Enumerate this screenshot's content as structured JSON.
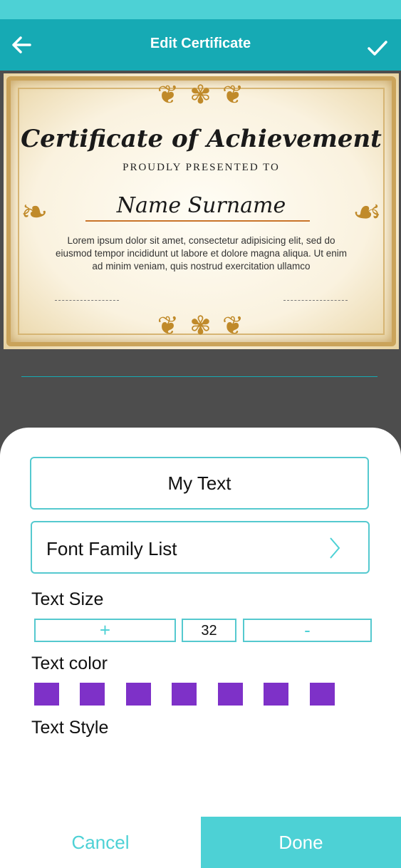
{
  "toolbar": {
    "title": "Edit Certificate",
    "back_icon": "arrow-left-icon",
    "confirm_icon": "check-icon"
  },
  "certificate": {
    "heading": "Certificate of Achievement",
    "subheading": "PROUDLY PRESENTED TO",
    "name": "Name Surname",
    "body": "Lorem ipsum dolor sit amet, consectetur adipisicing elit, sed do eiusmod tempor incididunt ut labore et dolore magna aliqua. Ut enim ad minim veniam, quis nostrud exercitation ullamco"
  },
  "editor": {
    "text_value": "My Text",
    "font_family_label": "Font Family List",
    "text_size_label": "Text Size",
    "increase_label": "+",
    "size_value": "32",
    "decrease_label": "-",
    "text_color_label": "Text color",
    "swatch_color": "#7e31c8",
    "swatch_count": 7,
    "text_style_label": "Text Style"
  },
  "actions": {
    "cancel_label": "Cancel",
    "done_label": "Done"
  },
  "colors": {
    "status_bar": "#4dd1d5",
    "toolbar": "#16aab4",
    "accent": "#4dd1d5"
  }
}
